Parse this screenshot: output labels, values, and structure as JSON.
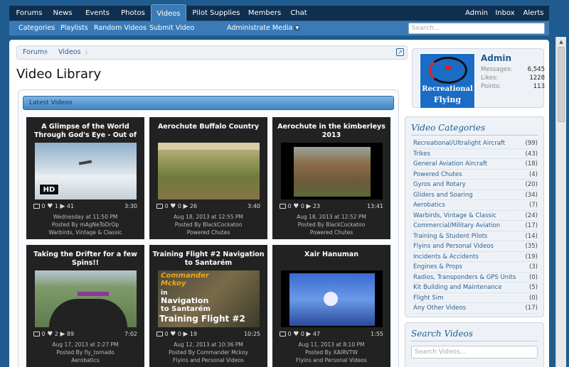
{
  "topnav": {
    "tabs": [
      "Forums",
      "News",
      "Events",
      "Photos",
      "Videos",
      "Pilot Supplies",
      "Members",
      "Chat"
    ],
    "active": "Videos",
    "user_links": [
      "Admin",
      "Inbox",
      "Alerts"
    ]
  },
  "subnav": {
    "items": [
      "Categories",
      "Playlists",
      "Random Videos",
      "Submit Video"
    ],
    "administrate": "Administrate Media",
    "search_placeholder": "Search..."
  },
  "breadcrumb": [
    "Forums",
    "Videos"
  ],
  "page_title": "Video Library",
  "latest_label": "Latest Videos",
  "videos": [
    {
      "title": "A Glimpse of the World Through God's Eye - Out of",
      "comments": "0",
      "likes": "1",
      "views": "41",
      "duration": "3:30",
      "date": "Wednesday at 11:50 PM",
      "posted_by": "Posted By mAgNeToDrOp",
      "category": "Warbirds, Vintage & Classic",
      "hd": "HD"
    },
    {
      "title": "Aerochute Buffalo Country",
      "comments": "0",
      "likes": "0",
      "views": "26",
      "duration": "3:40",
      "date": "Aug 18, 2013 at 12:55 PM",
      "posted_by": "Posted By BlackCockatoo",
      "category": "Powered Chutes"
    },
    {
      "title": "Aerochute in the kimberleys 2013",
      "comments": "0",
      "likes": "0",
      "views": "23",
      "duration": "13:41",
      "date": "Aug 18, 2013 at 12:52 PM",
      "posted_by": "Posted By BlackCockatoo",
      "category": "Powered Chutes"
    },
    {
      "title": "Taking the Drifter for a few Spins!!",
      "comments": "0",
      "likes": "2",
      "views": "89",
      "duration": "7:02",
      "date": "Aug 17, 2013 at 2:27 PM",
      "posted_by": "Posted By fly_tornado",
      "category": "Aerobatics"
    },
    {
      "title": "Training Flight #2 Navigation to Santarém",
      "comments": "0",
      "likes": "0",
      "views": "19",
      "duration": "10:25",
      "date": "Aug 12, 2013 at 10:36 PM",
      "posted_by": "Posted By Commander Mckoy",
      "category": "Flyins and Personal Videos",
      "thumb_text": [
        "Commander",
        "Mckoy",
        "in",
        "Navigation",
        "to Santarém",
        "Training Flight #2"
      ]
    },
    {
      "title": "Xair Hanuman",
      "comments": "0",
      "likes": "0",
      "views": "47",
      "duration": "1:55",
      "date": "Aug 11, 2013 at 8:10 PM",
      "posted_by": "Posted By XAIRVTW",
      "category": "Flyins and Personal Videos"
    }
  ],
  "profile": {
    "name": "Admin",
    "avatar_text": [
      "Recreational",
      "Flying"
    ],
    "stats": [
      {
        "label": "Messages:",
        "value": "6,545"
      },
      {
        "label": "Likes:",
        "value": "1228"
      },
      {
        "label": "Points:",
        "value": "113"
      }
    ]
  },
  "categories_title": "Video Categories",
  "categories": [
    {
      "name": "Recreational/Ultralight Aircraft",
      "count": "(99)"
    },
    {
      "name": "Trikes",
      "count": "(43)"
    },
    {
      "name": "General Aviation Aircraft",
      "count": "(18)"
    },
    {
      "name": "Powered Chutes",
      "count": "(4)"
    },
    {
      "name": "Gyros and Rotary",
      "count": "(20)"
    },
    {
      "name": "Gliders and Soaring",
      "count": "(34)"
    },
    {
      "name": "Aerobatics",
      "count": "(7)"
    },
    {
      "name": "Warbirds, Vintage & Classic",
      "count": "(24)"
    },
    {
      "name": "Commercial/Military Aviation",
      "count": "(17)"
    },
    {
      "name": "Training & Student Pilots",
      "count": "(14)"
    },
    {
      "name": "Flyins and Personal Videos",
      "count": "(35)"
    },
    {
      "name": "Incidents & Accidents",
      "count": "(19)"
    },
    {
      "name": "Engines & Props",
      "count": "(3)"
    },
    {
      "name": "Radios, Transponders & GPS Units",
      "count": "(0)"
    },
    {
      "name": "Kit Building and Maintenance",
      "count": "(5)"
    },
    {
      "name": "Flight Sim",
      "count": "(0)"
    },
    {
      "name": "Any Other Videos",
      "count": "(17)"
    }
  ],
  "search_videos_title": "Search Videos",
  "search_videos_placeholder": "Search Videos..."
}
